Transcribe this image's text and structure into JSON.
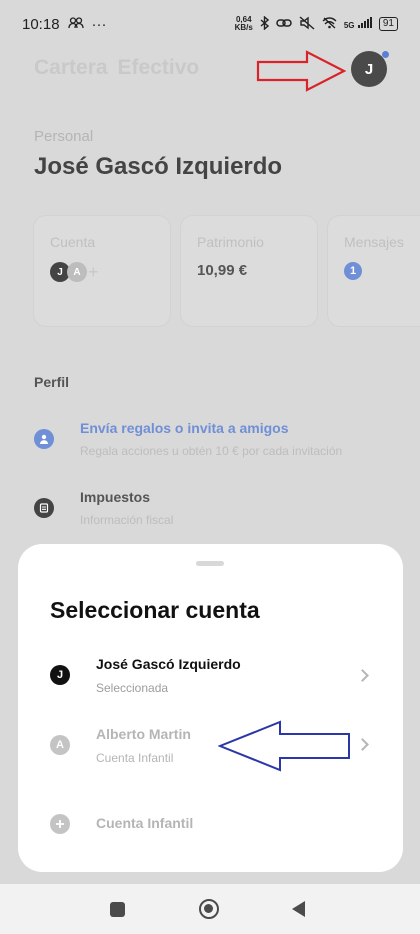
{
  "status_bar": {
    "time": "10:18",
    "net_speed_value": "0,64",
    "net_speed_unit": "KB/s",
    "signal_label": "5G",
    "battery": "91"
  },
  "tabs": [
    {
      "label": "Cartera"
    },
    {
      "label": "Efectivo"
    }
  ],
  "profile_avatar_initial": "J",
  "personal_label": "Personal",
  "user_name": "José Gascó Izquierdo",
  "cards": {
    "cuenta": {
      "title": "Cuenta",
      "avatars": [
        "J",
        "A"
      ],
      "plus": "+"
    },
    "patrimonio": {
      "title": "Patrimonio",
      "value": "10,99 €"
    },
    "mensajes": {
      "title": "Mensajes",
      "badge": "1"
    }
  },
  "perfil_label": "Perfil",
  "rows": [
    {
      "title": "Envía regalos o invita a amigos",
      "subtitle": "Regala acciones u obtén 10 € por cada invitación",
      "icon": "person-icon"
    },
    {
      "title": "Impuestos",
      "subtitle": "Información fiscal",
      "icon": "document-icon"
    }
  ],
  "sheet": {
    "title": "Seleccionar cuenta",
    "accounts": [
      {
        "initial": "J",
        "name": "José Gascó Izquierdo",
        "status": "Seleccionada"
      },
      {
        "initial": "A",
        "name": "Alberto Martin",
        "status": "Cuenta Infantil"
      }
    ],
    "add_label": "Cuenta Infantil",
    "add_icon": "plus-circle-icon"
  },
  "colors": {
    "accent_blue": "#5b7fd6",
    "annotation_red": "#d9232a",
    "annotation_blue": "#2a37a8"
  }
}
